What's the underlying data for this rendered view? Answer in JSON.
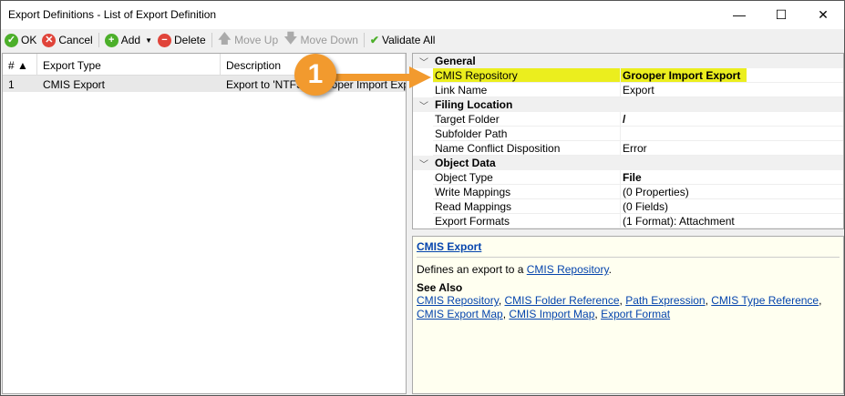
{
  "window": {
    "title": "Export Definitions - List of Export Definition",
    "minimize": "—",
    "maximize": "☐",
    "close": "✕"
  },
  "toolbar": {
    "ok": "OK",
    "cancel": "Cancel",
    "add": "Add",
    "delete": "Delete",
    "move_up": "Move Up",
    "move_down": "Move Down",
    "validate_all": "Validate All"
  },
  "list": {
    "headers": [
      "# ▲",
      "Export Type",
      "Description"
    ],
    "rows": [
      {
        "num": "1",
        "type": "CMIS Export",
        "description": "Export to 'NTFS - Grooper Import Exp..."
      }
    ]
  },
  "callout": "1",
  "grid": {
    "categories": [
      {
        "name": "General",
        "props": [
          {
            "k": "CMIS Repository",
            "v": "Grooper Import Export"
          },
          {
            "k": "Link Name",
            "v": "Export"
          }
        ]
      },
      {
        "name": "Filing Location",
        "props": [
          {
            "k": "Target Folder",
            "v": "/"
          },
          {
            "k": "Subfolder Path",
            "v": ""
          },
          {
            "k": "Name Conflict Disposition",
            "v": "Error"
          }
        ]
      },
      {
        "name": "Object Data",
        "props": [
          {
            "k": "Object Type",
            "v": "File"
          },
          {
            "k": "Write Mappings",
            "v": "(0 Properties)"
          },
          {
            "k": "Read Mappings",
            "v": "(0 Fields)"
          },
          {
            "k": "Export Formats",
            "v": "(1 Format): Attachment"
          }
        ]
      }
    ]
  },
  "help": {
    "title": "CMIS Export",
    "desc_prefix": "Defines an export to a ",
    "desc_link": "CMIS Repository",
    "desc_suffix": ".",
    "see_also": "See Also",
    "links": [
      "CMIS Repository",
      "CMIS Folder Reference",
      "Path Expression",
      "CMIS Type Reference",
      "CMIS Export Map",
      "CMIS Import Map",
      "Export Format"
    ]
  }
}
